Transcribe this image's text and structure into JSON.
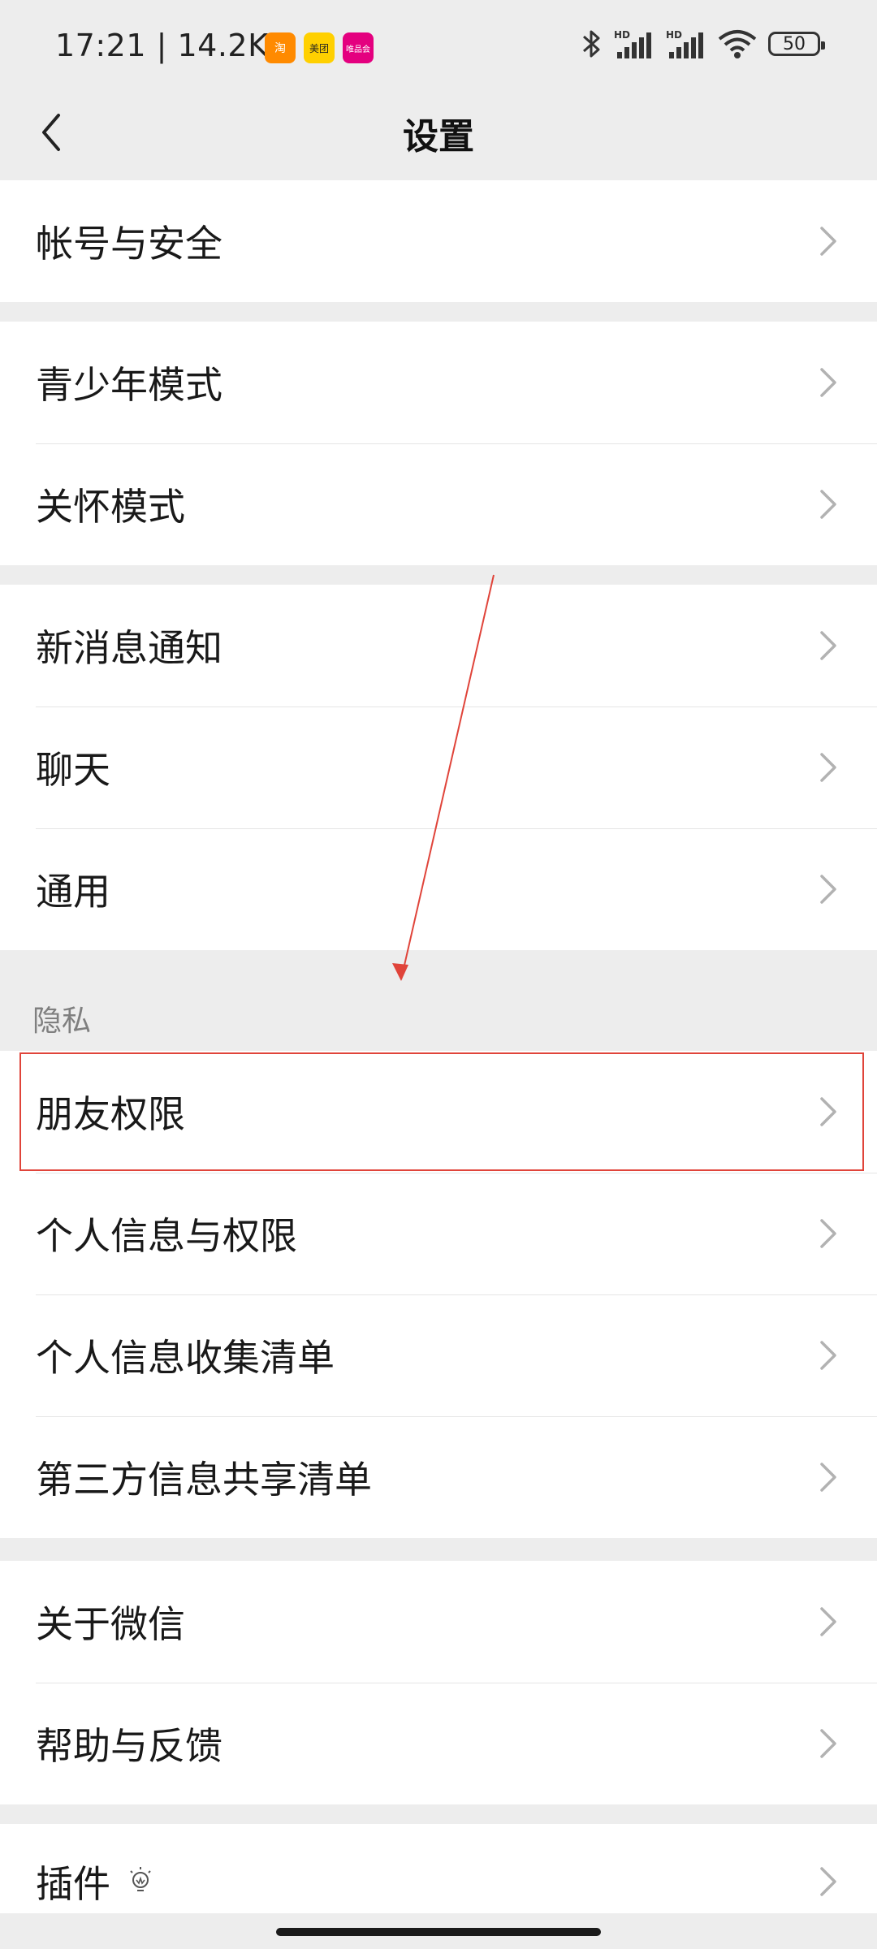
{
  "status": {
    "time_speed": "17:21 | 14.2K/s",
    "battery": "50",
    "badges": [
      "淘",
      "美团",
      "唯品会"
    ]
  },
  "nav": {
    "title": "设置"
  },
  "groups": [
    [
      "帐号与安全"
    ],
    [
      "青少年模式",
      "关怀模式"
    ],
    [
      "新消息通知",
      "聊天",
      "通用"
    ],
    [
      "朋友权限",
      "个人信息与权限",
      "个人信息收集清单",
      "第三方信息共享清单"
    ],
    [
      "关于微信",
      "帮助与反馈"
    ],
    [
      "插件"
    ]
  ],
  "privacy_header": "隐私",
  "colors": {
    "highlight": "#e0443a",
    "background": "#ededed",
    "row_bg": "#ffffff"
  }
}
